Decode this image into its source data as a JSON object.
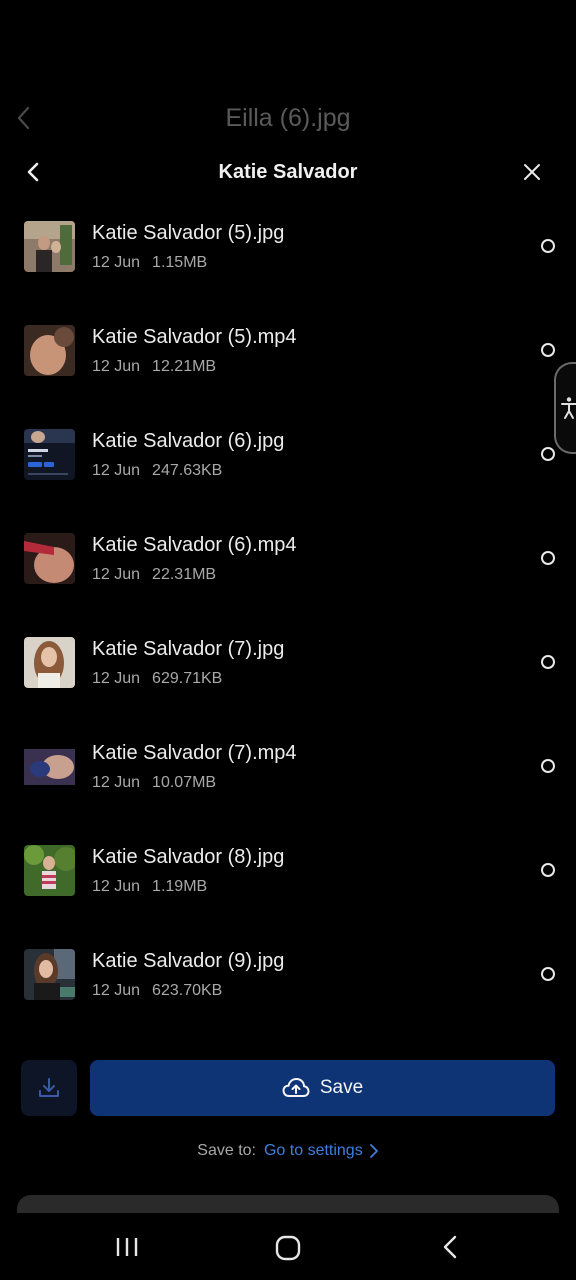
{
  "background_screen": {
    "title": "Eilla (6).jpg"
  },
  "sheet": {
    "title": "Katie Salvador"
  },
  "files": [
    {
      "name": "Katie Salvador (5).jpg",
      "date": "12 Jun",
      "size": "1.15MB",
      "thumb_icon": "photo-thumbnail"
    },
    {
      "name": "Katie Salvador (5).mp4",
      "date": "12 Jun",
      "size": "12.21MB",
      "thumb_icon": "video-thumbnail"
    },
    {
      "name": "Katie Salvador (6).jpg",
      "date": "12 Jun",
      "size": "247.63KB",
      "thumb_icon": "screenshot-thumbnail"
    },
    {
      "name": "Katie Salvador (6).mp4",
      "date": "12 Jun",
      "size": "22.31MB",
      "thumb_icon": "video-thumbnail"
    },
    {
      "name": "Katie Salvador (7).jpg",
      "date": "12 Jun",
      "size": "629.71KB",
      "thumb_icon": "photo-thumbnail"
    },
    {
      "name": "Katie Salvador (7).mp4",
      "date": "12 Jun",
      "size": "10.07MB",
      "thumb_icon": "video-thumbnail"
    },
    {
      "name": "Katie Salvador (8).jpg",
      "date": "12 Jun",
      "size": "1.19MB",
      "thumb_icon": "photo-thumbnail"
    },
    {
      "name": "Katie Salvador (9).jpg",
      "date": "12 Jun",
      "size": "623.70KB",
      "thumb_icon": "photo-thumbnail"
    }
  ],
  "actions": {
    "save_label": "Save",
    "save_to_label": "Save to:",
    "settings_link": "Go to settings"
  },
  "colors": {
    "background": "#000000",
    "save_button": "#0f3476",
    "link": "#3d7fe0",
    "download_button": "#0d1526"
  }
}
